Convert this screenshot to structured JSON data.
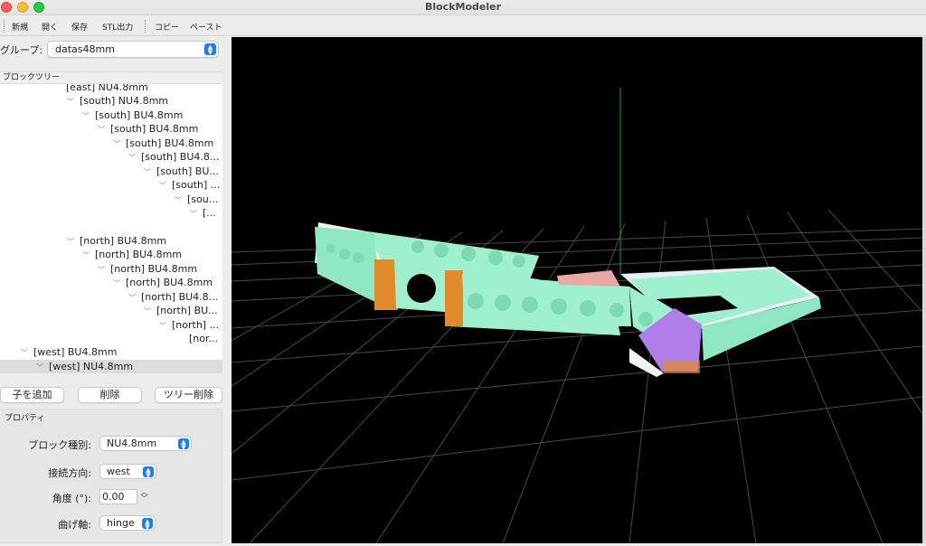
{
  "window": {
    "title": "BlockModeler"
  },
  "toolbar": {
    "new": "新規",
    "open": "開く",
    "save": "保存",
    "stl": "STL出力",
    "copy": "コピー",
    "paste": "ペースト"
  },
  "group": {
    "label": "グループ:",
    "value": "datas48mm"
  },
  "tree": {
    "header": "ブロックツリー",
    "rows": [
      "[east] NU4.8mm",
      "[south] NU4.8mm",
      "[south] BU4.8mm",
      "[south] BU4.8mm",
      "[south] BU4.8mm",
      "[south] BU4.8...",
      "[south] BU...",
      "[south] ...",
      "[sou...",
      "[...",
      "[north] BU4.8mm",
      "[north] BU4.8mm",
      "[north] BU4.8mm",
      "[north] BU4.8mm",
      "[north] BU4.8...",
      "[north] BU...",
      "[north] ...",
      "[nor...",
      "[west] BU4.8mm",
      "[west] NU4.8mm"
    ]
  },
  "buttons": {
    "add_child": "子を追加",
    "delete": "削除",
    "delete_tree": "ツリー削除"
  },
  "properties": {
    "title": "プロパティ",
    "block_type_label": "ブロック種別:",
    "block_type_value": "NU4.8mm",
    "direction_label": "接続方向:",
    "direction_value": "west",
    "angle_label": "角度 (°):",
    "angle_value": "0.00",
    "bend_axis_label": "曲げ軸:",
    "bend_axis_value": "hinge"
  },
  "colors": {
    "block_mint": "#9ff0cf",
    "block_white": "#f2f4f6",
    "joint_orange": "#e08a2c",
    "joint_purple": "#b07ee8",
    "joint_pink": "#e7a8a6",
    "grid": "#4a4a4a",
    "axis_green": "#1f9e2c"
  }
}
